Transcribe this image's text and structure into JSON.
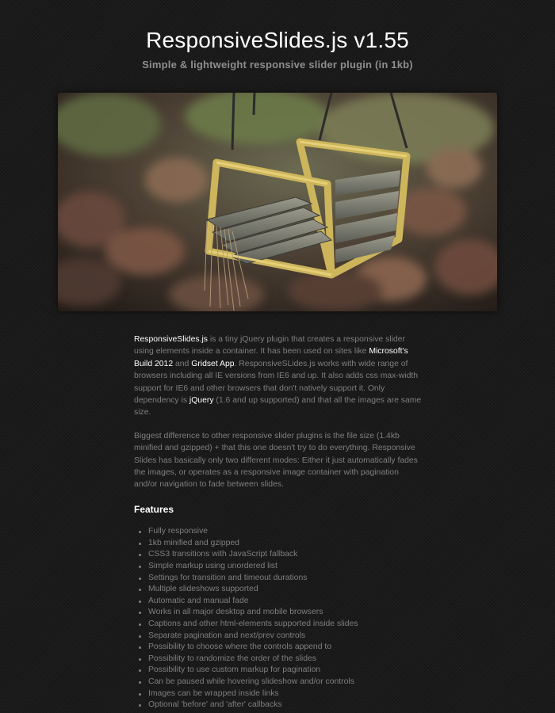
{
  "header": {
    "title": "ResponsiveSlides.js v1.55",
    "subtitle": "Simple & lightweight responsive slider plugin (in 1kb)"
  },
  "slider": {
    "image_description_icon": "swing-photo"
  },
  "intro": {
    "link_name": "ResponsiveSlides.js",
    "text1": " is a tiny jQuery plugin that creates a responsive slider using elements inside a container. It has been used on sites like ",
    "link_microsoft": "Microsoft's Build 2012",
    "text2": " and ",
    "link_gridset": "Gridset App",
    "text3": ". ResponsiveSLides.js works with wide range of browsers including all IE versions from IE6 and up. It also adds css max-width support for IE6 and other browsers that don't natively support it. Only dependency is ",
    "link_jquery": "jQuery",
    "text4": " (1.6 and up supported) and that all the images are same size."
  },
  "paragraph2": "Biggest difference to other responsive slider plugins is the file size (1.4kb minified and gzipped) + that this one doesn't try to do everything. Responsive Slides has basically only two different modes: Either it just automatically fades the images, or operates as a responsive image container with pagination and/or navigation to fade between slides.",
  "features": {
    "heading": "Features",
    "items": [
      "Fully responsive",
      "1kb minified and gzipped",
      "CSS3 transitions with JavaScript fallback",
      "Simple markup using unordered list",
      "Settings for transition and timeout durations",
      "Multiple slideshows supported",
      "Automatic and manual fade",
      "Works in all major desktop and mobile browsers",
      "Captions and other html-elements supported inside slides",
      "Separate pagination and next/prev controls",
      "Possibility to choose where the controls append to",
      "Possibility to randomize the order of the slides",
      "Possibility to use custom markup for pagination",
      "Can be paused while hovering slideshow and/or controls",
      "Images can be wrapped inside links",
      "Optional 'before' and 'after' callbacks"
    ]
  },
  "colors": {
    "background": "#1b1b1b",
    "text": "#7f7f7f",
    "link": "#ffffff",
    "swing_frame": "#d9c16a"
  }
}
